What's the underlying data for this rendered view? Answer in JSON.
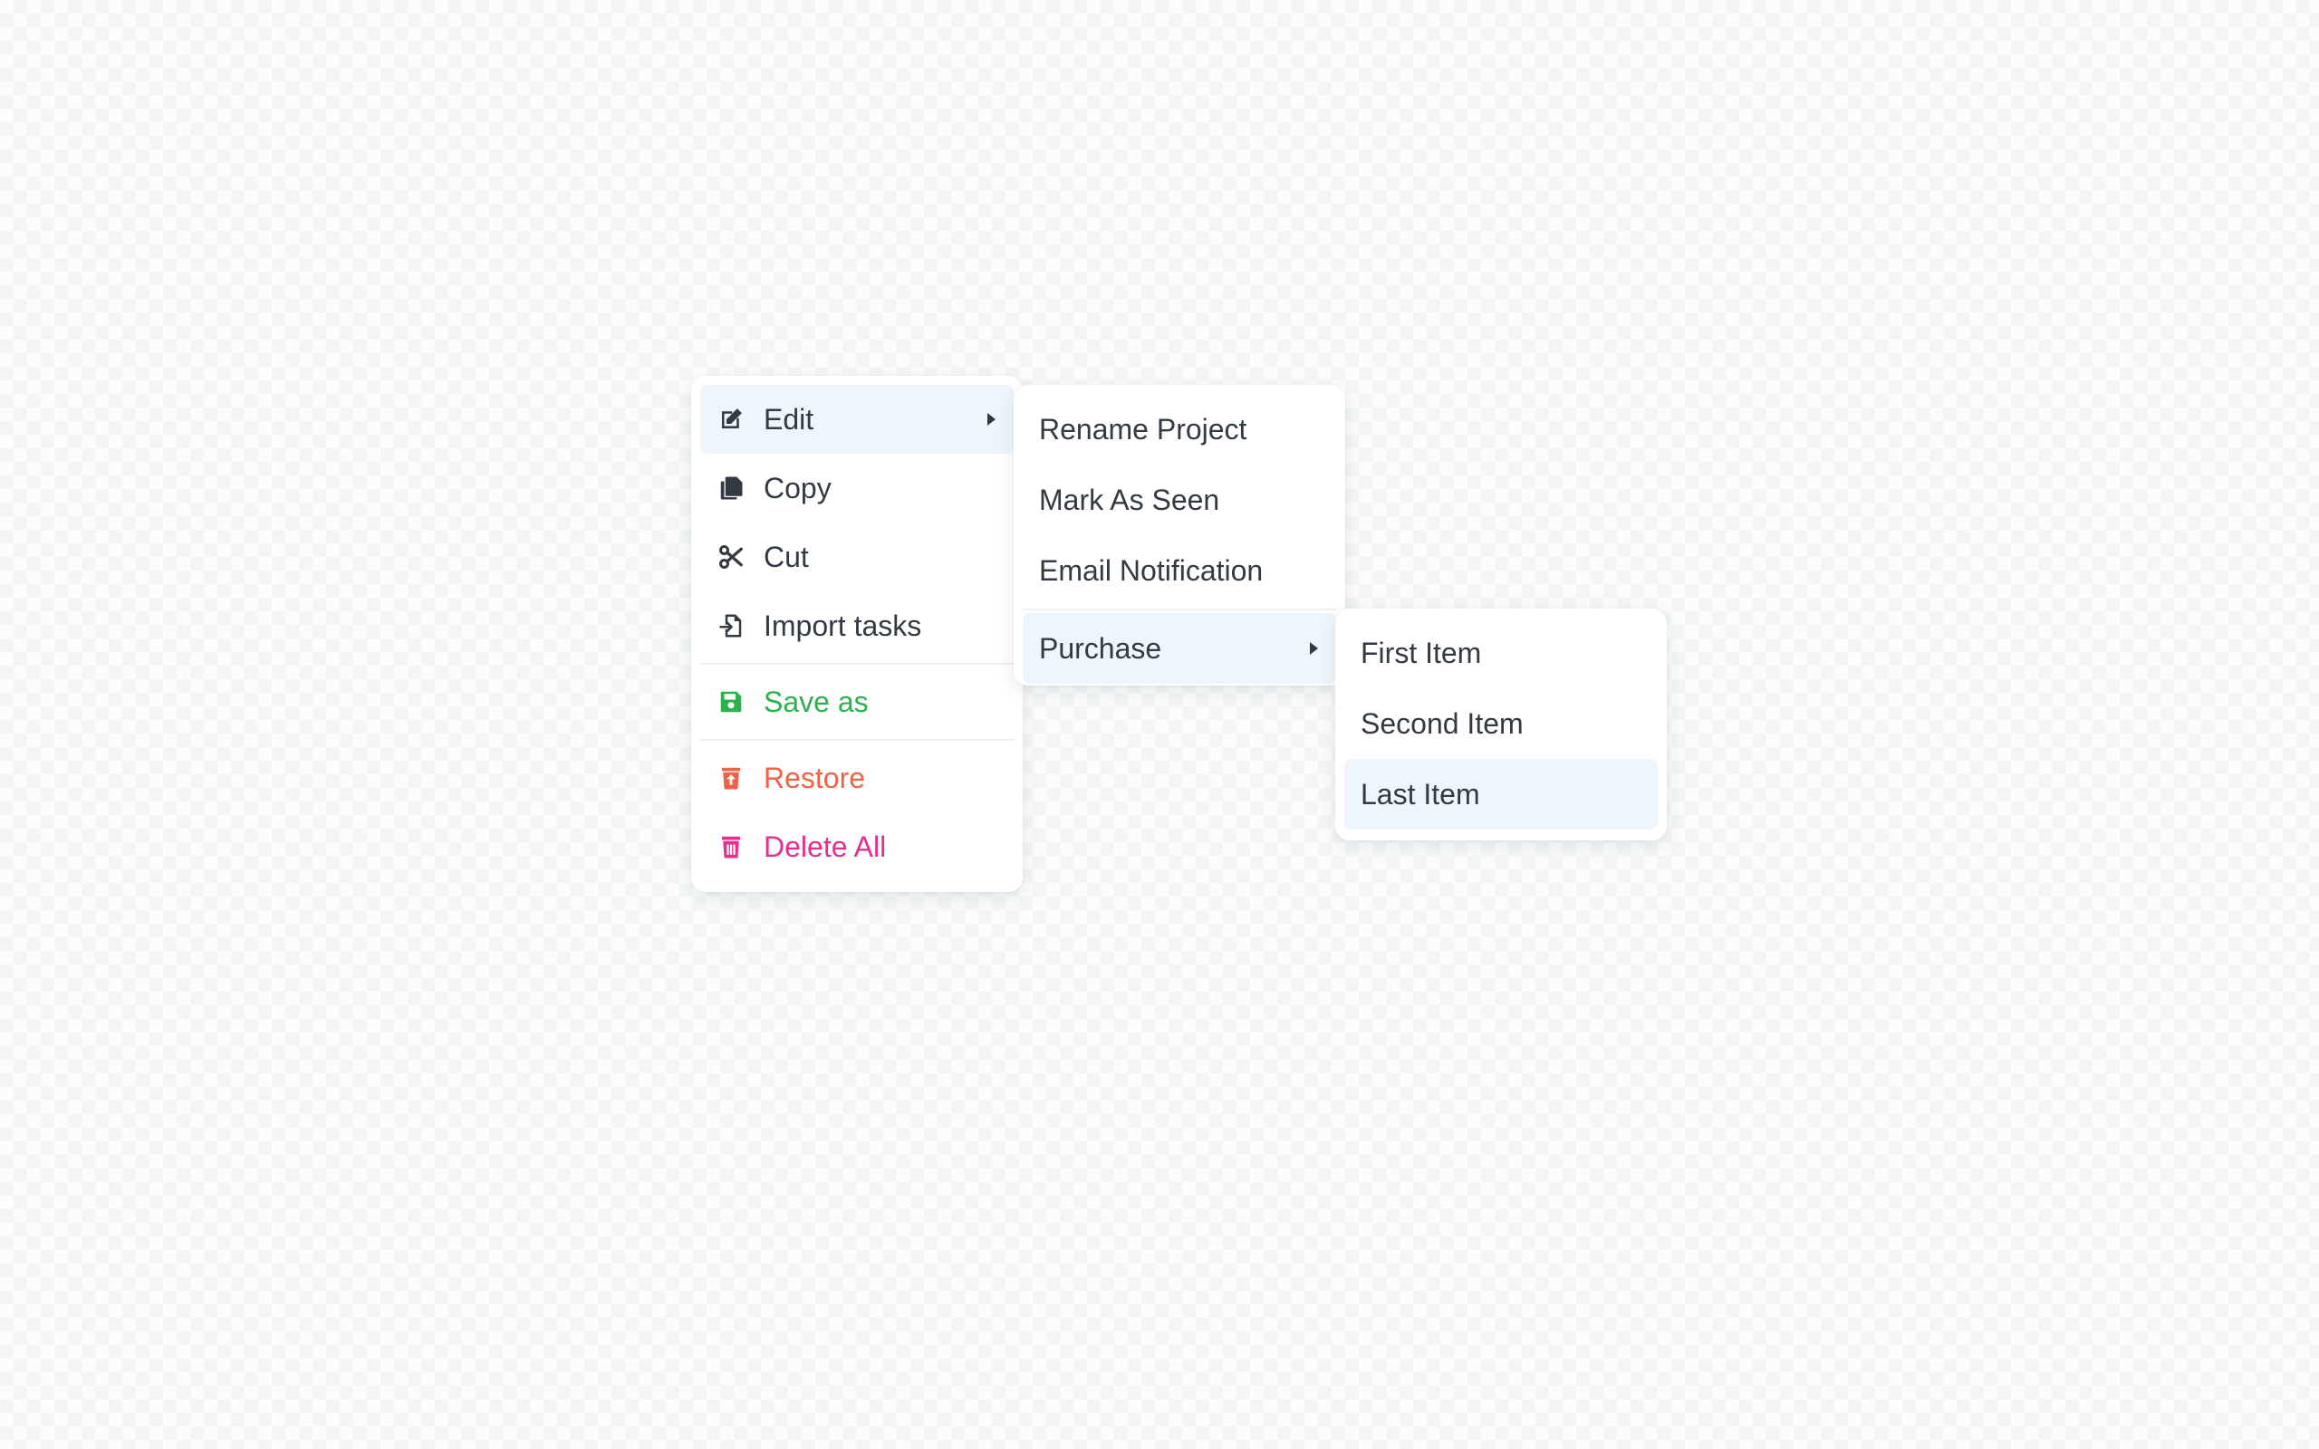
{
  "main_menu": {
    "items": [
      {
        "label": "Edit",
        "icon": "edit-icon",
        "has_submenu": true,
        "active": true
      },
      {
        "label": "Copy",
        "icon": "copy-icon"
      },
      {
        "label": "Cut",
        "icon": "scissors-icon"
      },
      {
        "label": "Import tasks",
        "icon": "file-import-icon"
      },
      {
        "label": "Save as",
        "icon": "save-icon",
        "color": "#2bb24c"
      },
      {
        "label": "Restore",
        "icon": "trash-restore-icon",
        "color": "#f16148"
      },
      {
        "label": "Delete All",
        "icon": "trash-icon",
        "color": "#ea2c8f"
      }
    ]
  },
  "edit_submenu": {
    "items": [
      {
        "label": "Rename Project"
      },
      {
        "label": "Mark As Seen"
      },
      {
        "label": "Email Notification"
      },
      {
        "label": "Purchase",
        "has_submenu": true,
        "active": true
      }
    ]
  },
  "purchase_submenu": {
    "items": [
      {
        "label": "First Item"
      },
      {
        "label": "Second Item"
      },
      {
        "label": "Last Item",
        "active": true
      }
    ]
  },
  "colors": {
    "hover_background": "#eef5fd",
    "text": "#333a44",
    "success": "#2bb24c",
    "warning": "#f16148",
    "danger": "#ea2c8f"
  }
}
